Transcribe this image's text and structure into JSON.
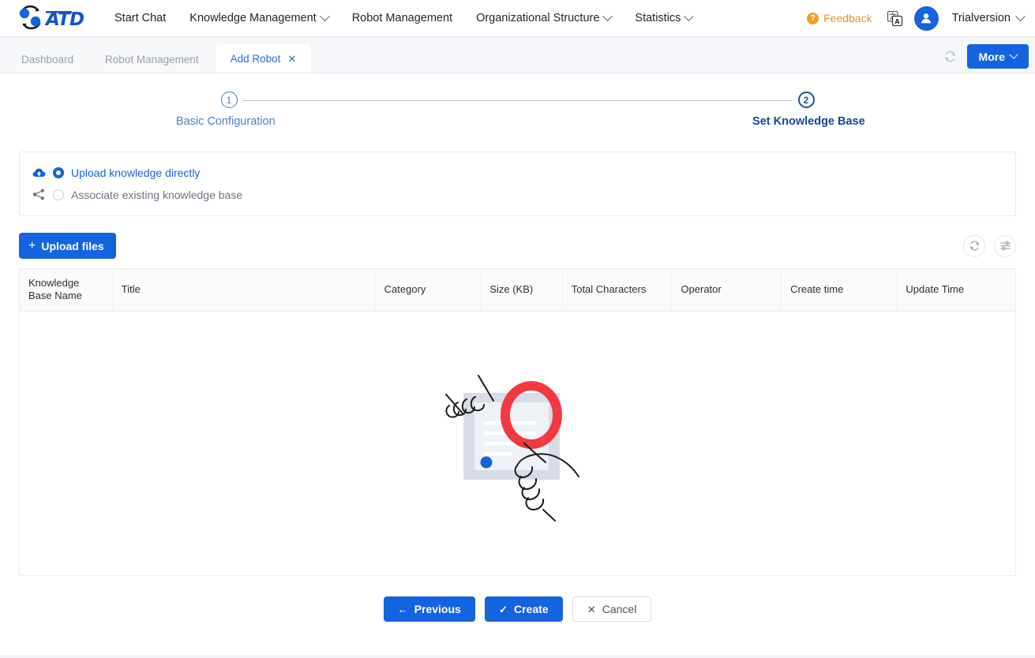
{
  "brand": {
    "name": "AID",
    "logo_alt": "aid-logo"
  },
  "nav": {
    "items": [
      {
        "label": "Start Chat",
        "has_dropdown": false
      },
      {
        "label": "Knowledge Management",
        "has_dropdown": true
      },
      {
        "label": "Robot Management",
        "has_dropdown": false
      },
      {
        "label": "Organizational Structure",
        "has_dropdown": true
      },
      {
        "label": "Statistics",
        "has_dropdown": true
      }
    ]
  },
  "topright": {
    "feedback_label": "Feedback",
    "feedback_color": "#e8901e",
    "language_icon": "translate-icon",
    "user_name": "Trialversion"
  },
  "tabs": {
    "items": [
      {
        "label": "Dashboard",
        "active": false,
        "closable": false
      },
      {
        "label": "Robot Management",
        "active": false,
        "closable": false
      },
      {
        "label": "Add Robot",
        "active": true,
        "closable": true
      }
    ],
    "close_glyph": "✕",
    "refresh_icon": "refresh-icon",
    "more_label": "More"
  },
  "stepper": {
    "steps": [
      {
        "number": "1",
        "label": "Basic Configuration",
        "state": "done"
      },
      {
        "number": "2",
        "label": "Set Knowledge Base",
        "state": "active"
      }
    ]
  },
  "source": {
    "options": [
      {
        "label": "Upload knowledge directly",
        "icon": "cloud-upload-icon",
        "selected": true
      },
      {
        "label": "Associate existing knowledge base",
        "icon": "share-nodes-icon",
        "selected": false
      }
    ]
  },
  "toolbar": {
    "upload_label": "Upload files",
    "plus_glyph": "+",
    "refresh_icon": "refresh-icon",
    "settings_icon": "sliders-icon"
  },
  "table": {
    "columns": [
      "Knowledge Base Name",
      "Title",
      "Category",
      "Size (KB)",
      "Total Characters",
      "Operator",
      "Create time",
      "Update Time"
    ],
    "rows": [],
    "empty_illustration": "magnifier-document-illustration"
  },
  "footer": {
    "previous_label": "Previous",
    "previous_icon": "←",
    "create_label": "Create",
    "create_icon": "✓",
    "cancel_label": "Cancel",
    "cancel_icon": "✕"
  },
  "colors": {
    "primary": "#1464e0",
    "accent_orange": "#e8901e",
    "step_active": "#13479e",
    "illustration_red": "#f2393f",
    "illustration_blue": "#1464e0"
  }
}
